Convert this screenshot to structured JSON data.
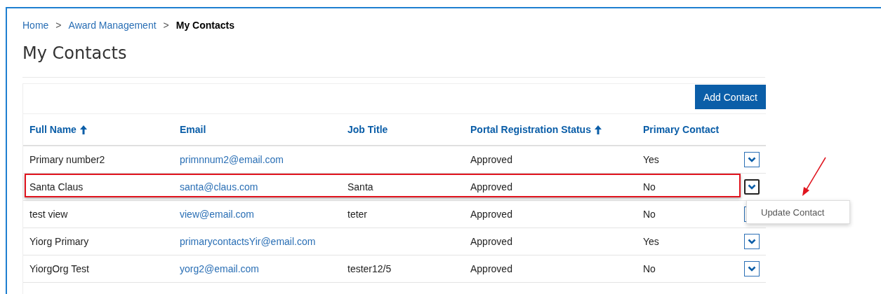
{
  "breadcrumb": [
    {
      "label": "Home",
      "current": false
    },
    {
      "label": "Award Management",
      "current": false
    },
    {
      "label": "My Contacts",
      "current": true
    }
  ],
  "breadcrumb_separator": ">",
  "title": "My Contacts",
  "add_button": "Add Contact",
  "table": {
    "columns": [
      {
        "label": "Full Name",
        "sorted": true
      },
      {
        "label": "Email",
        "sorted": false
      },
      {
        "label": "Job Title",
        "sorted": false
      },
      {
        "label": "Portal Registration Status",
        "sorted": true
      },
      {
        "label": "Primary Contact",
        "sorted": false
      }
    ],
    "rows": [
      {
        "name": "Primary number2",
        "email": "primnnum2@email.com",
        "job": "",
        "status": "Approved",
        "primary": "Yes",
        "highlighted": false,
        "menu_open": false
      },
      {
        "name": "Santa Claus",
        "email": "santa@claus.com",
        "job": "Santa",
        "status": "Approved",
        "primary": "No",
        "highlighted": true,
        "menu_open": true
      },
      {
        "name": "test view",
        "email": "view@email.com",
        "job": "teter",
        "status": "Approved",
        "primary": "No",
        "highlighted": false,
        "menu_open": false
      },
      {
        "name": "Yiorg Primary",
        "email": "primarycontactsYir@email.com",
        "job": "",
        "status": "Approved",
        "primary": "Yes",
        "highlighted": false,
        "menu_open": false
      },
      {
        "name": "YiorgOrg Test",
        "email": "yorg2@email.com",
        "job": "tester12/5",
        "status": "Approved",
        "primary": "No",
        "highlighted": false,
        "menu_open": false
      }
    ]
  },
  "row_menu": {
    "items": [
      "Update Contact"
    ]
  }
}
